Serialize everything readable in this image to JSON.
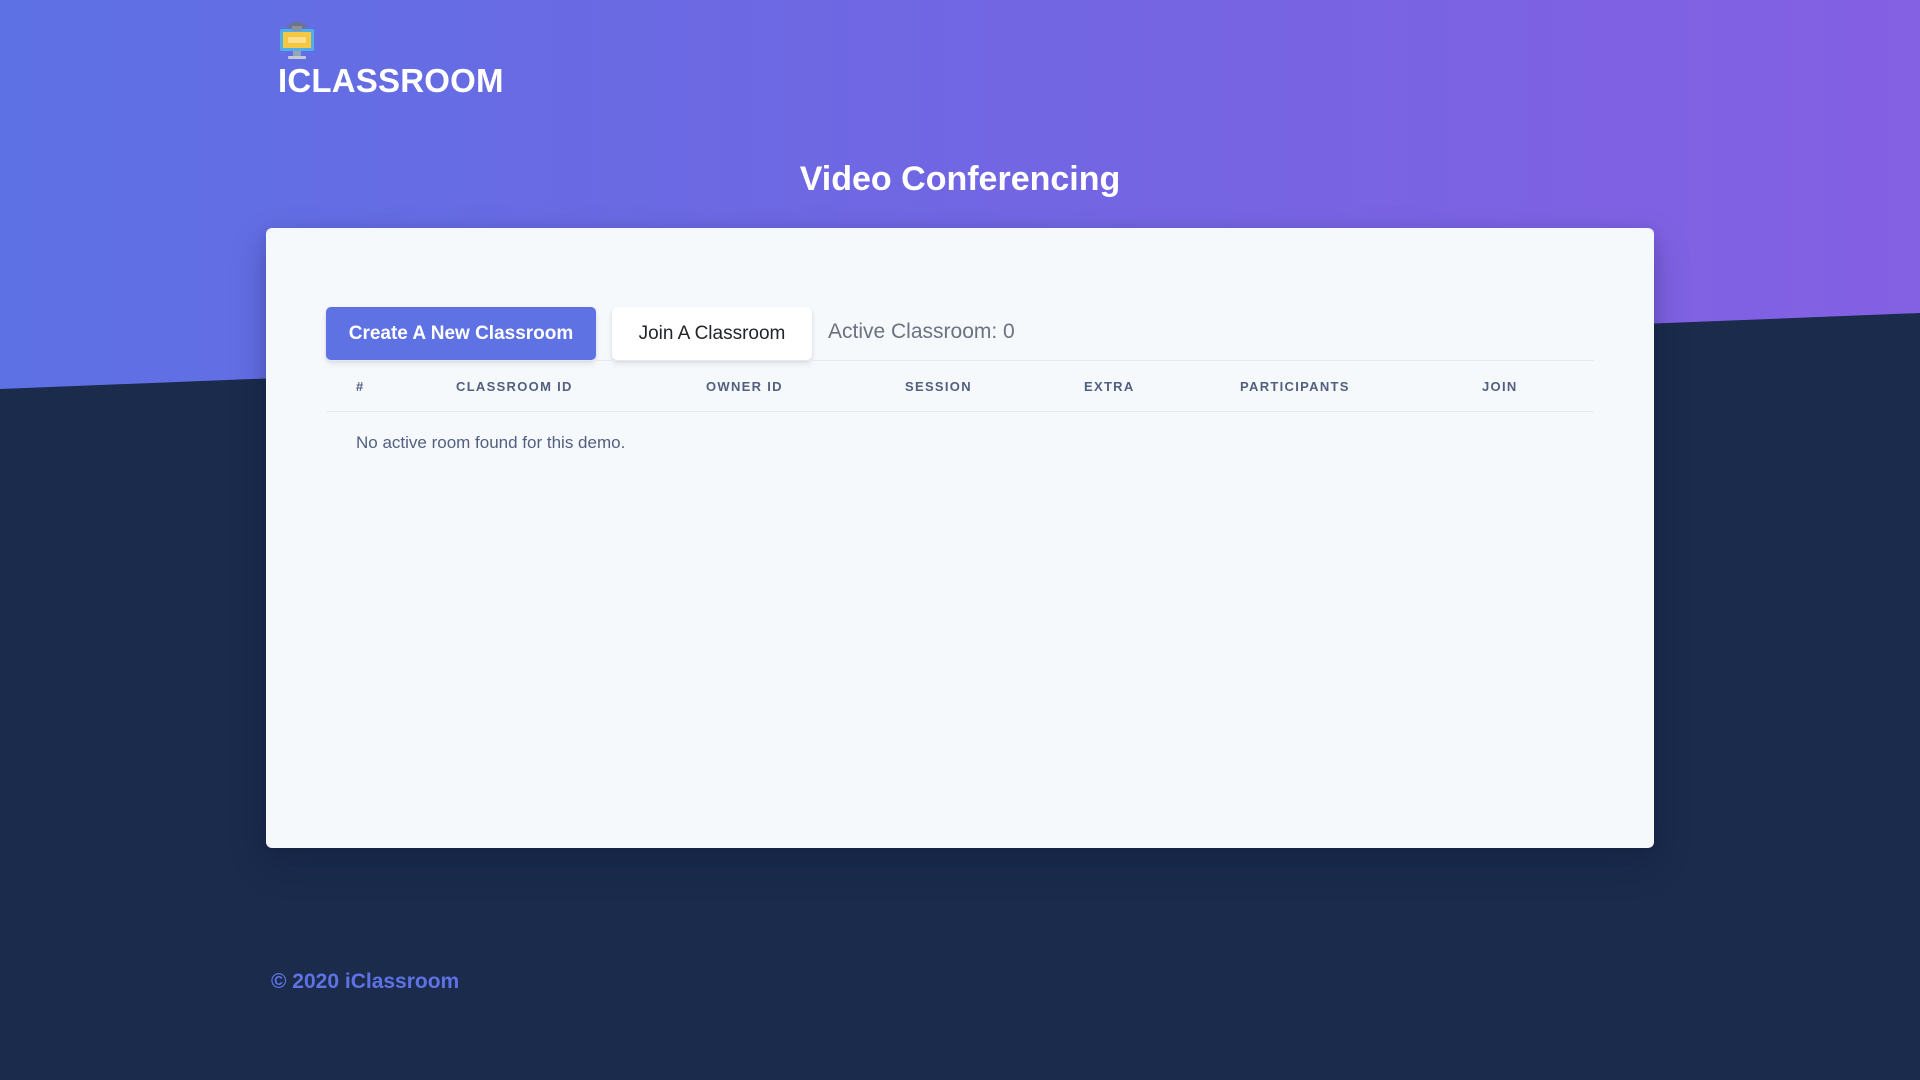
{
  "header": {
    "logo_icon": "classroom-computer-icon",
    "brand": "ICLASSROOM",
    "page_title": "Video Conferencing"
  },
  "toolbar": {
    "create_label": "Create A New Classroom",
    "join_label": "Join A Classroom",
    "active_count": "Active Classroom: 0"
  },
  "table": {
    "columns": [
      "#",
      "CLASSROOM ID",
      "OWNER ID",
      "SESSION",
      "EXTRA",
      "PARTICIPANTS",
      "JOIN"
    ],
    "empty_message": "No active room found for this demo."
  },
  "footer": {
    "copyright": "© 2020 iClassroom"
  },
  "colors": {
    "gradient_start": "#5d71e4",
    "gradient_end": "#8460e3",
    "background_dark": "#1a2b4c",
    "primary": "#5e72e4"
  }
}
